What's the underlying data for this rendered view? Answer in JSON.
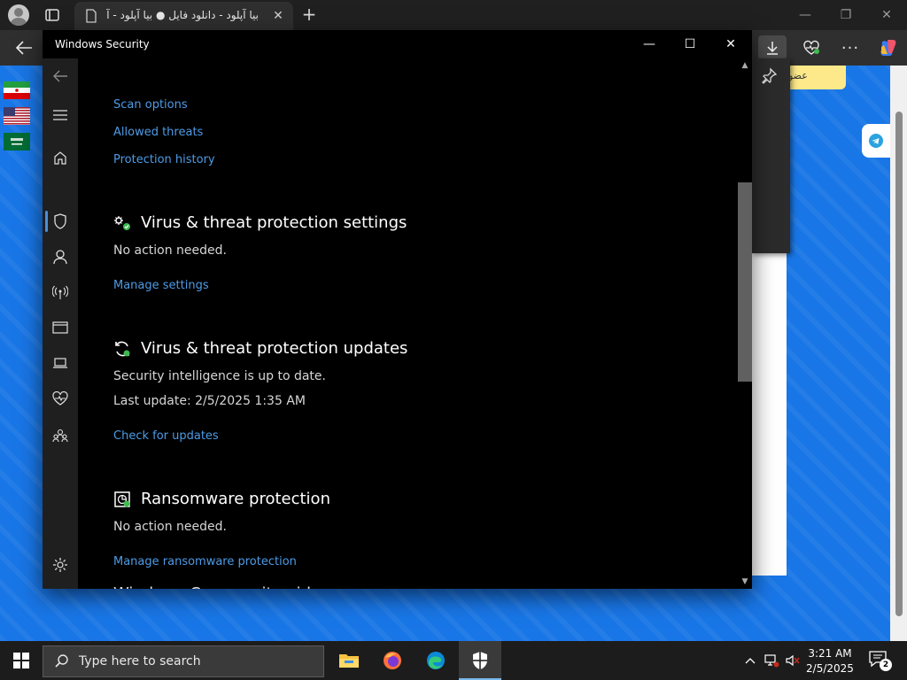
{
  "browser": {
    "tab_title": "بیا آپلود - دانلود فایل ● بیا آپلود - آپ",
    "tab_close": "✕",
    "new_tab": "+",
    "window_minimize": "—",
    "window_restore": "❐",
    "window_close": "✕",
    "more_menu": "···"
  },
  "page": {
    "yellow_button_label": "عضو"
  },
  "windows_security": {
    "title": "Windows Security",
    "minimize": "—",
    "maximize": "☐",
    "close": "✕",
    "top_links": [
      "Scan options",
      "Allowed threats",
      "Protection history"
    ],
    "sections": [
      {
        "title": "Virus & threat protection settings",
        "icon": "gears-check-icon",
        "lines": [
          "No action needed."
        ],
        "link": "Manage settings"
      },
      {
        "title": "Virus & threat protection updates",
        "icon": "refresh-icon",
        "lines": [
          "Security intelligence is up to date.",
          "Last update: 2/5/2025 1:35 AM"
        ],
        "link": "Check for updates"
      },
      {
        "title": "Ransomware protection",
        "icon": "ransomware-icon",
        "lines": [
          "No action needed."
        ],
        "link": "Manage ransomware protection"
      }
    ],
    "clipped_heading": "Windows Community videos",
    "nav_icons": [
      "back-icon",
      "hamburger-icon",
      "home-icon",
      "shield-icon",
      "account-icon",
      "firewall-icon",
      "app-browser-icon",
      "device-security-icon",
      "health-icon",
      "family-icon",
      "settings-icon"
    ]
  },
  "taskbar": {
    "search_placeholder": "Type here to search",
    "time": "3:21 AM",
    "date": "2/5/2025",
    "notification_count": "2"
  },
  "colors": {
    "link": "#4d9be6",
    "page_blue": "#1976e6",
    "accent": "#76b9ed"
  }
}
